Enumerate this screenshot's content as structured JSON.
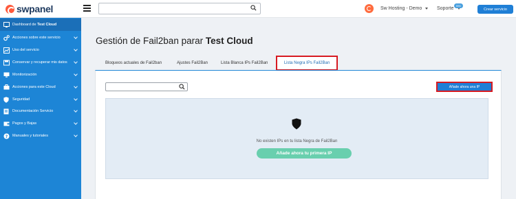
{
  "app": {
    "logo_text": "swpanel"
  },
  "header": {
    "search_placeholder": "",
    "account_name": "Sw Hosting - Demo",
    "support_label": "Soporte",
    "support_badge": "590",
    "create_button": "Crear servicio"
  },
  "sidebar": {
    "items": [
      {
        "prefix": "Dashboard de ",
        "bold": "Test Cloud",
        "icon": "dashboard-icon"
      },
      {
        "label": "Acciones sobre este servicio",
        "icon": "gears-icon"
      },
      {
        "label": "Uso del servicio",
        "icon": "chart-icon"
      },
      {
        "label": "Conservar y recuperar mis datos",
        "icon": "backup-icon"
      },
      {
        "label": "Monitorización",
        "icon": "monitor-icon"
      },
      {
        "label": "Acciones para este Cloud",
        "icon": "toolbox-icon"
      },
      {
        "label": "Seguridad",
        "icon": "shield-icon"
      },
      {
        "label": "Documentación Servicio",
        "icon": "document-icon"
      },
      {
        "label": "Pagos y Bajas",
        "icon": "wallet-icon"
      },
      {
        "label": "Manuales y tutoriales",
        "icon": "help-icon"
      }
    ]
  },
  "main": {
    "title_prefix": "Gestión de Fail2ban parar ",
    "title_bold": "Test Cloud",
    "tabs": [
      {
        "label": "Bloqueos actuales de Fail2ban"
      },
      {
        "label": "Ajustes Fail2Ban"
      },
      {
        "label": "Lista Blanca IPs Fail2Ban"
      },
      {
        "label": "Lista Negra IPs Fail2Ban"
      }
    ],
    "search_placeholder": "",
    "add_ip_button": "Añade ahora una IP",
    "empty_message": "No existen IPs en tu lista Negra de Fail2Ban",
    "add_first_button": "Añade ahora tu primera IP"
  },
  "colors": {
    "sidebar": "#1d85d6",
    "primary": "#1f7fd6",
    "highlight": "#d71920",
    "success": "#69cfae"
  }
}
